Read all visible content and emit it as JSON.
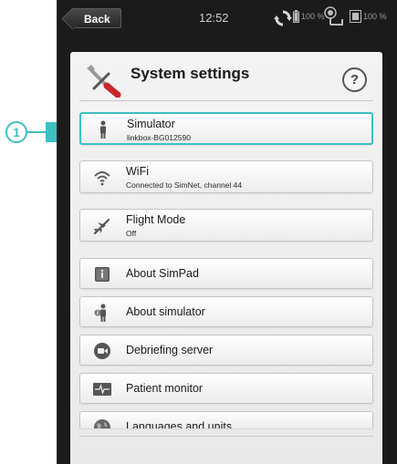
{
  "status_bar": {
    "back_label": "Back",
    "time": "12:52",
    "battery_1_percent": "100 %",
    "battery_2_percent": "100 %"
  },
  "header": {
    "title": "System settings",
    "help_label": "?"
  },
  "callout": {
    "number": "1"
  },
  "menu": {
    "items": [
      {
        "label": "Simulator",
        "sublabel": "linkbox-BG012590",
        "icon": "person-icon"
      },
      {
        "label": "WiFi",
        "sublabel": "Connected to SimNet, channel 44",
        "icon": "wifi-icon"
      },
      {
        "label": "Flight Mode",
        "sublabel": "Off",
        "icon": "airplane-icon"
      },
      {
        "label": "About SimPad",
        "icon": "info-icon"
      },
      {
        "label": "About simulator",
        "icon": "person-info-icon"
      },
      {
        "label": "Debriefing server",
        "icon": "camera-icon"
      },
      {
        "label": "Patient monitor",
        "icon": "monitor-icon"
      },
      {
        "label": "Languages and units",
        "icon": "globe-icon"
      }
    ]
  },
  "colors": {
    "accent": "#3cc0c2",
    "device_frame": "#1b1b1b",
    "panel_bg": "#eeeeee"
  }
}
